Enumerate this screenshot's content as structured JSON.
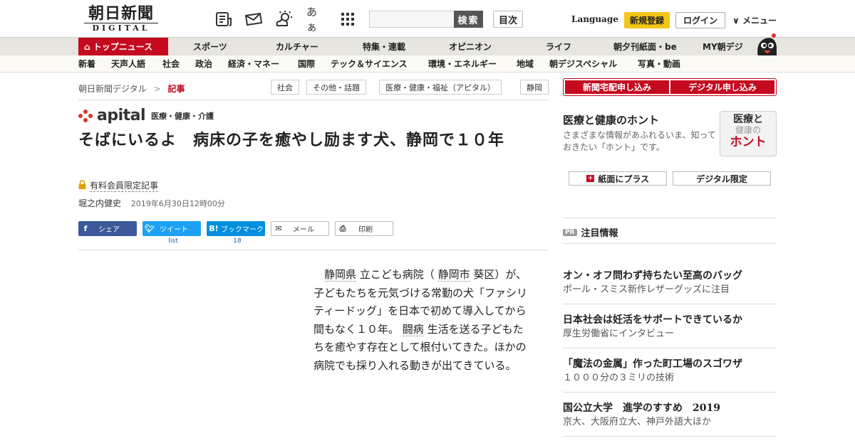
{
  "header": {
    "logo_main": "朝日新聞",
    "logo_sub": "DIGITAL",
    "search_button": "検索",
    "contents_button": "目次",
    "language": "Language",
    "register": "新規登録",
    "login": "ログイン",
    "menu": "メニュー",
    "font_size_icon_text": "あぁ"
  },
  "nav_main": [
    "トップニュース",
    "スポーツ",
    "カルチャー",
    "特集・連載",
    "オピニオン",
    "ライフ",
    "朝夕刊紙面・be",
    "MY朝デジ"
  ],
  "nav_sub": [
    "新着",
    "天声人語",
    "社会",
    "政治",
    "経済・マネー",
    "国際",
    "テック＆サイエンス",
    "環境・エネルギー",
    "地域",
    "朝デジスペシャル",
    "写真・動画"
  ],
  "breadcrumb": {
    "site": "朝日新聞デジタル",
    "sep": ">",
    "current": "記事"
  },
  "tags": [
    "社会",
    "その他・話題",
    "医療・健康・福祉（アピタル）",
    "静岡"
  ],
  "apital": {
    "brand": "apital",
    "sub": "医療・健康・介護"
  },
  "article": {
    "title": "そばにいるよ　病床の子を癒やし励ます犬、静岡で１０年",
    "paid_label": "有料会員限定記事",
    "author": "堀之内健史",
    "date": "2019年6月30日12時00分",
    "body_link1": "静岡県",
    "body_1": "立こども病院（",
    "body_link2": "静岡市",
    "body_2": "葵区）が、子どもたちを元気づける常勤の犬「ファシリティードッグ」を日本で初めて導入してから間もなく１０年。",
    "body_link3": "闘病",
    "body_3": "生活を送る子どもたちを癒やす存在として根付いてきた。ほかの病院でも採り入れる動きが出てきている。"
  },
  "share": {
    "facebook": "シェア",
    "twitter": "ツイート",
    "hatena": "ブックマーク",
    "mail": "メール",
    "print": "印刷",
    "twitter_count": "list",
    "hatena_count": "18"
  },
  "right": {
    "btn_paper": "新聞宅配申し込み",
    "btn_digital": "デジタル申し込み",
    "honto_title": "医療と健康のホント",
    "honto_desc": "さまざまな情報があふれるいま、知っておきたい「ホント」です。",
    "honto_img_l1": "医療と",
    "honto_img_l2": "健康の",
    "honto_img_l3": "ホント",
    "plus_paper": "紙面にプラス",
    "digital_only": "デジタル限定",
    "pr_badge": "PR",
    "pr_label": "注目情報",
    "ads": [
      {
        "title": "オン・オフ問わず持ちたい至高のバッグ",
        "sub": "ポール・スミス新作レザーグッズに注目"
      },
      {
        "title": "日本社会は妊活をサポートできているか",
        "sub": "厚生労働省にインタビュー"
      },
      {
        "title": "「魔法の金属」作った町工場のスゴワザ",
        "sub": "１０００分の３ミリの技術"
      },
      {
        "title": "国公立大学　進学のすすめ　2019",
        "sub": "京大、大阪府立大、神戸外語大ほか"
      }
    ]
  }
}
